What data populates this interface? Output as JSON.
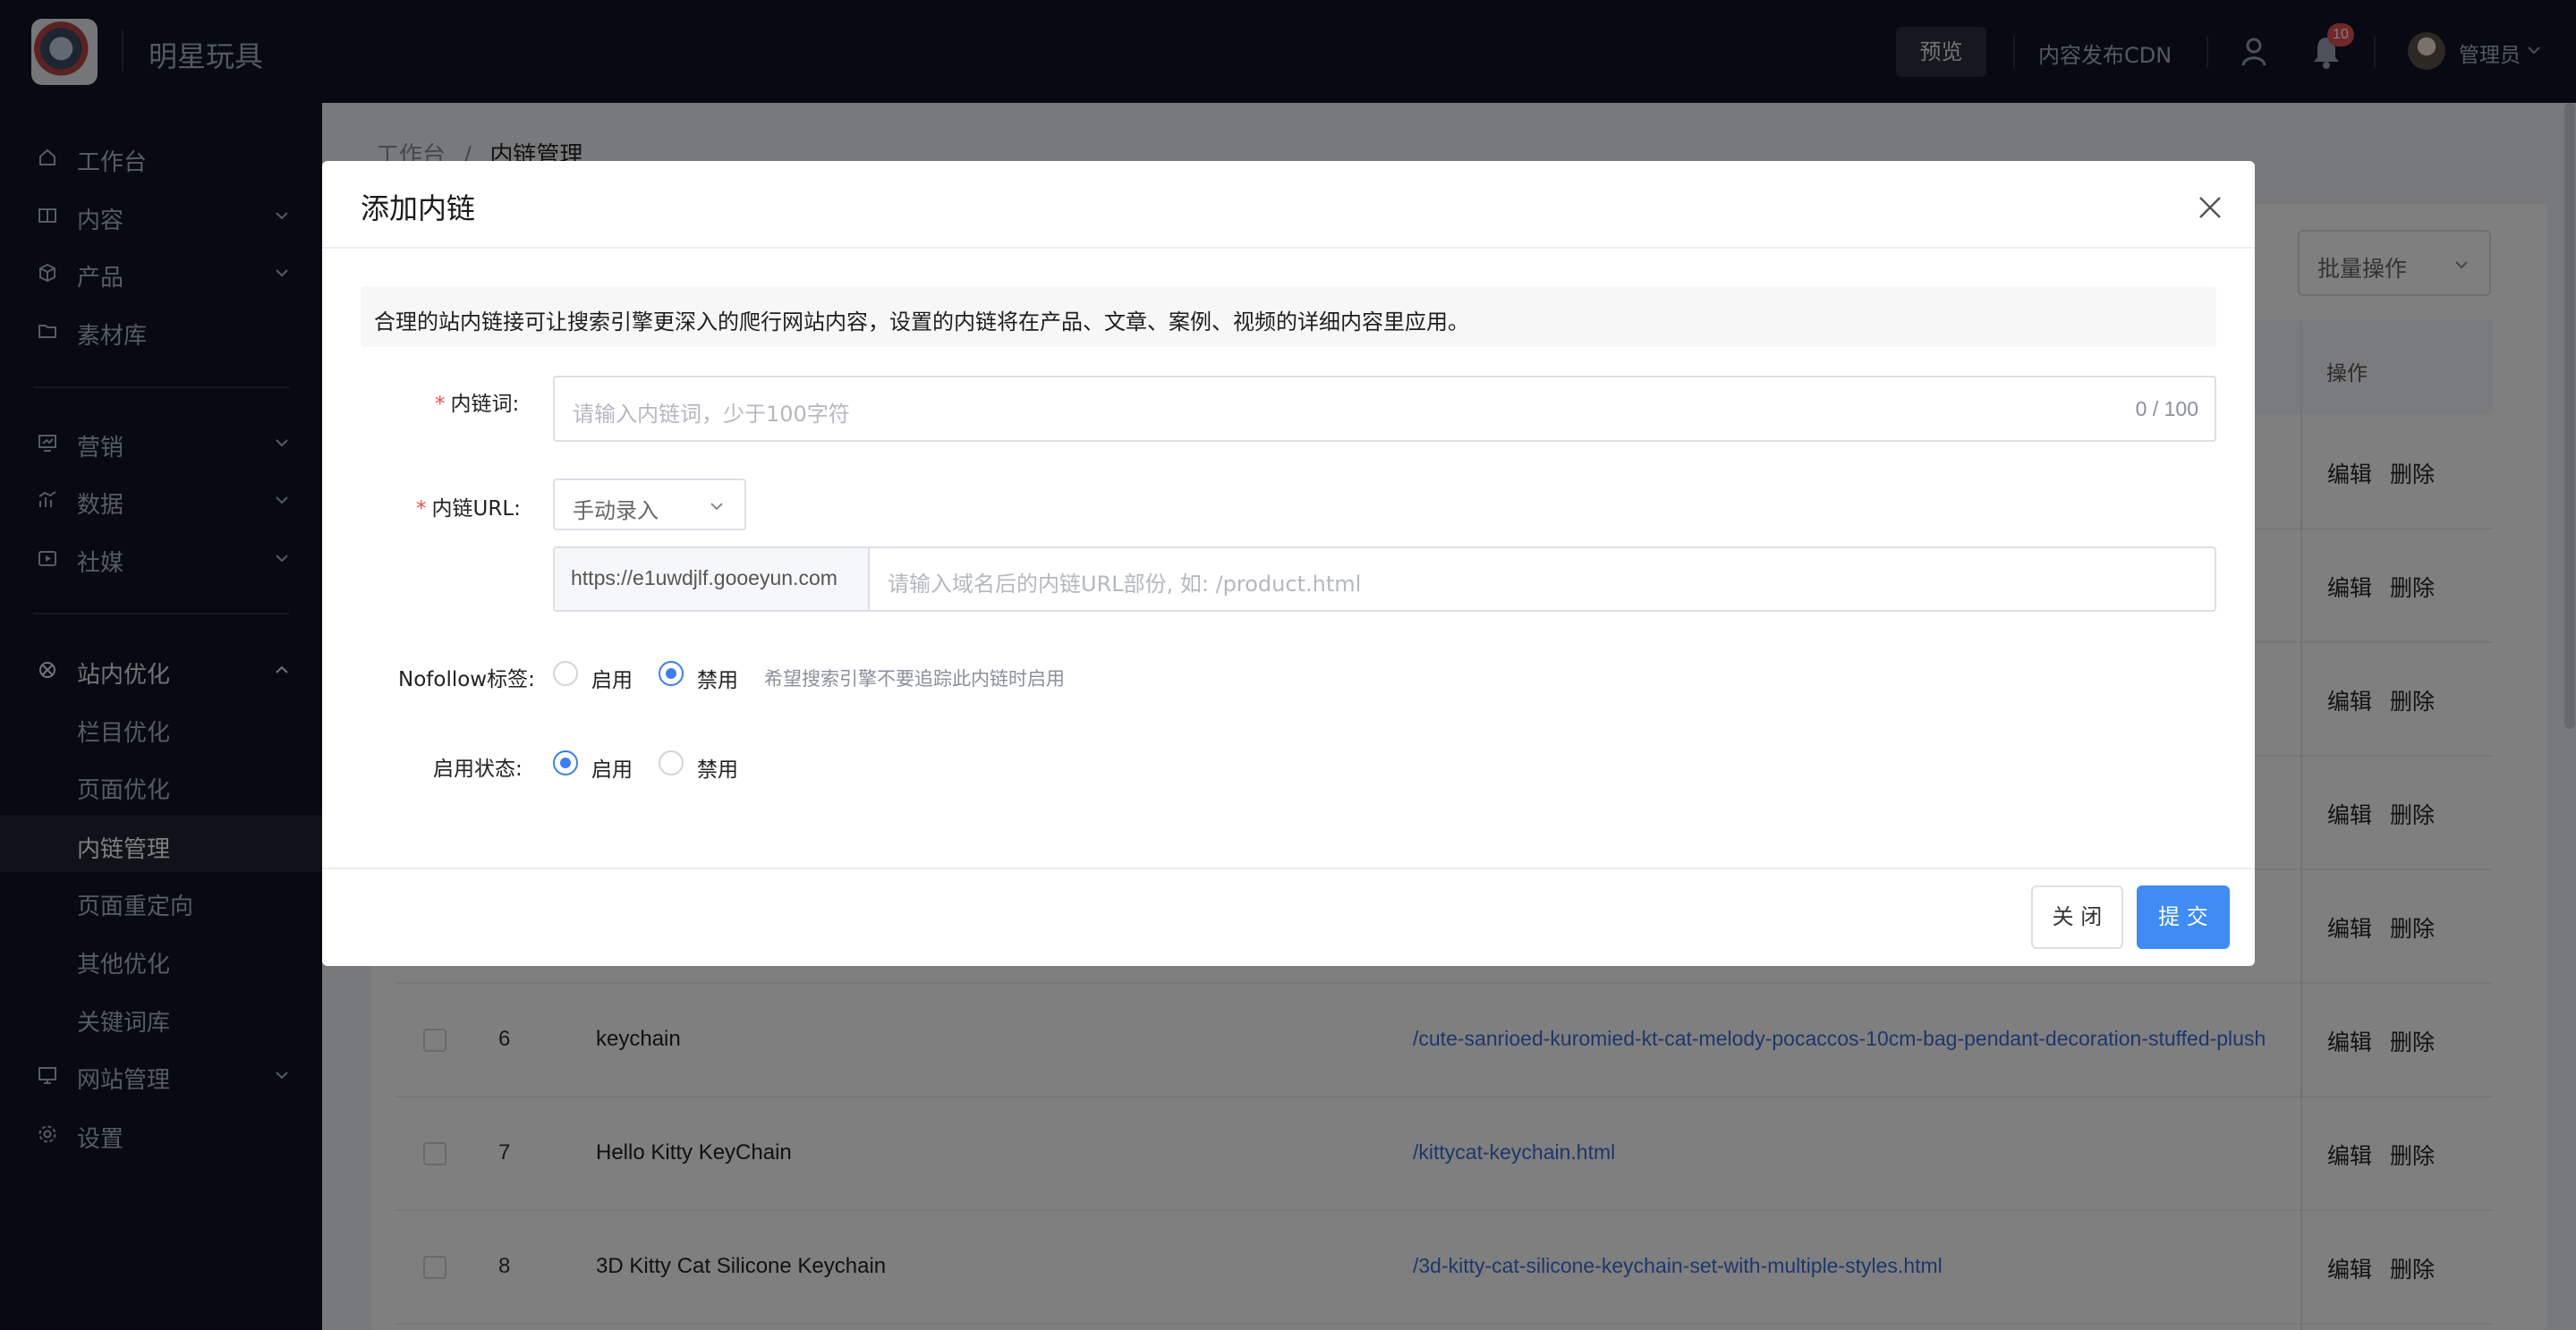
{
  "header": {
    "site_name": "明星玩具",
    "preview_label": "预览",
    "cdn_label": "内容发布CDN",
    "notification_count": "10",
    "admin_name": "管理员"
  },
  "sidebar": {
    "items": [
      {
        "label": "工作台",
        "icon": "home-icon"
      },
      {
        "label": "内容",
        "icon": "content-icon"
      },
      {
        "label": "产品",
        "icon": "product-icon"
      },
      {
        "label": "素材库",
        "icon": "folder-icon"
      },
      {
        "label": "营销",
        "icon": "marketing-icon"
      },
      {
        "label": "数据",
        "icon": "chart-icon"
      },
      {
        "label": "社媒",
        "icon": "social-icon"
      },
      {
        "label": "站内优化",
        "icon": "seo-icon"
      },
      {
        "label": "栏目优化"
      },
      {
        "label": "页面优化"
      },
      {
        "label": "内链管理"
      },
      {
        "label": "页面重定向"
      },
      {
        "label": "其他优化"
      },
      {
        "label": "关键词库"
      },
      {
        "label": "网站管理",
        "icon": "site-icon"
      },
      {
        "label": "设置",
        "icon": "gear-icon"
      }
    ]
  },
  "breadcrumb": {
    "root": "工作台",
    "separator": "/",
    "current": "内链管理"
  },
  "toolbar": {
    "batch_label": "批量操作"
  },
  "table": {
    "op_header": "操作",
    "edit_label": "编辑",
    "delete_label": "删除",
    "rows": [
      {
        "num": "6",
        "keyword": "keychain",
        "url": "/cute-sanrioed-kuromied-kt-cat-melody-pocaccos-10cm-bag-pendant-decoration-stuffed-plush"
      },
      {
        "num": "7",
        "keyword": "Hello Kitty KeyChain",
        "url": "/kittycat-keychain.html"
      },
      {
        "num": "8",
        "keyword": "3D Kitty Cat Silicone Keychain",
        "url": "/3d-kitty-cat-silicone-keychain-set-with-multiple-styles.html"
      }
    ]
  },
  "modal": {
    "title": "添加内链",
    "notice": "合理的站内链接可让搜索引擎更深入的爬行网站内容，设置的内链将在产品、文章、案例、视频的详细内容里应用。",
    "keyword_label": "内链词:",
    "keyword_placeholder": "请输入内链词，少于100字符",
    "keyword_counter": "0 / 100",
    "url_label": "内链URL:",
    "url_mode": "手动录入",
    "url_prefix": "https://e1uwdjlf.gooeyun.com",
    "url_placeholder": "请输入域名后的内链URL部份, 如: /product.html",
    "nofollow_label": "Nofollow标签:",
    "enable_label": "启用",
    "disable_label": "禁用",
    "nofollow_hint": "希望搜索引擎不要追踪此内链时启用",
    "status_label": "启用状态:",
    "close_button": "关 闭",
    "submit_button": "提 交"
  },
  "colors": {
    "accent": "#3e8cf4",
    "sidebar_bg": "#0f1524",
    "required": "#e25050"
  }
}
